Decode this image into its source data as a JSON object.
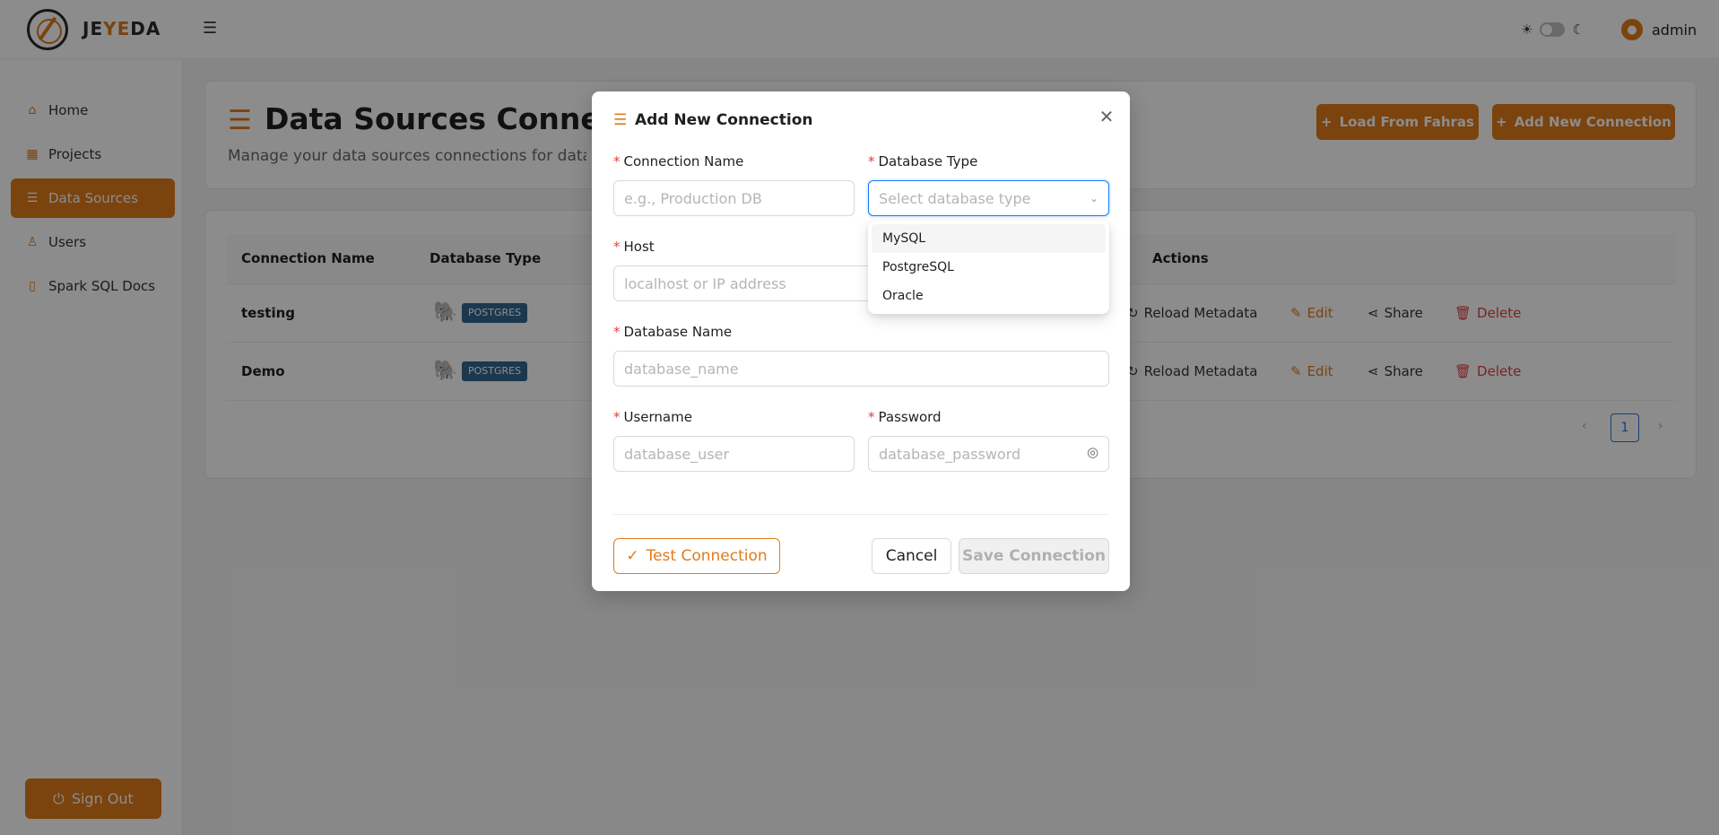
{
  "header": {
    "brand_prefix": "JE",
    "brand_mid": "YE",
    "brand_suffix": "DA",
    "user_name": "admin",
    "user_initial": "●"
  },
  "sidebar": {
    "items": [
      {
        "label": "Home",
        "icon": "home-icon"
      },
      {
        "label": "Projects",
        "icon": "projects-icon"
      },
      {
        "label": "Data Sources",
        "icon": "database-icon"
      },
      {
        "label": "Users",
        "icon": "user-icon"
      },
      {
        "label": "Spark SQL Docs",
        "icon": "book-icon"
      }
    ],
    "sign_out": "Sign Out"
  },
  "page": {
    "title": "Data Sources Connections",
    "subtitle": "Manage your data sources connections for data queries",
    "load_button": "Load From Fahras",
    "add_button": "Add New Connection"
  },
  "table": {
    "columns": [
      "Connection Name",
      "Database Type",
      "Actions"
    ],
    "rows": [
      {
        "name": "testing",
        "type": "POSTGRES"
      },
      {
        "name": "Demo",
        "type": "POSTGRES"
      }
    ],
    "actions": {
      "reload": "Reload Metadata",
      "edit": "Edit",
      "share": "Share",
      "delete": "Delete"
    },
    "current_page": "1"
  },
  "modal": {
    "title": "Add New Connection",
    "fields": {
      "connection_name": {
        "label": "Connection Name",
        "placeholder": "e.g., Production DB"
      },
      "database_type": {
        "label": "Database Type",
        "placeholder": "Select database type"
      },
      "host": {
        "label": "Host",
        "placeholder": "localhost or IP address"
      },
      "database_name": {
        "label": "Database Name",
        "placeholder": "database_name"
      },
      "username": {
        "label": "Username",
        "placeholder": "database_user"
      },
      "password": {
        "label": "Password",
        "placeholder": "database_password"
      }
    },
    "db_options": [
      "MySQL",
      "PostgreSQL",
      "Oracle"
    ],
    "test_button": "Test Connection",
    "cancel_button": "Cancel",
    "save_button": "Save Connection"
  },
  "colors": {
    "accent": "#e07b1b",
    "danger": "#e04040",
    "focus": "#1677ff"
  }
}
